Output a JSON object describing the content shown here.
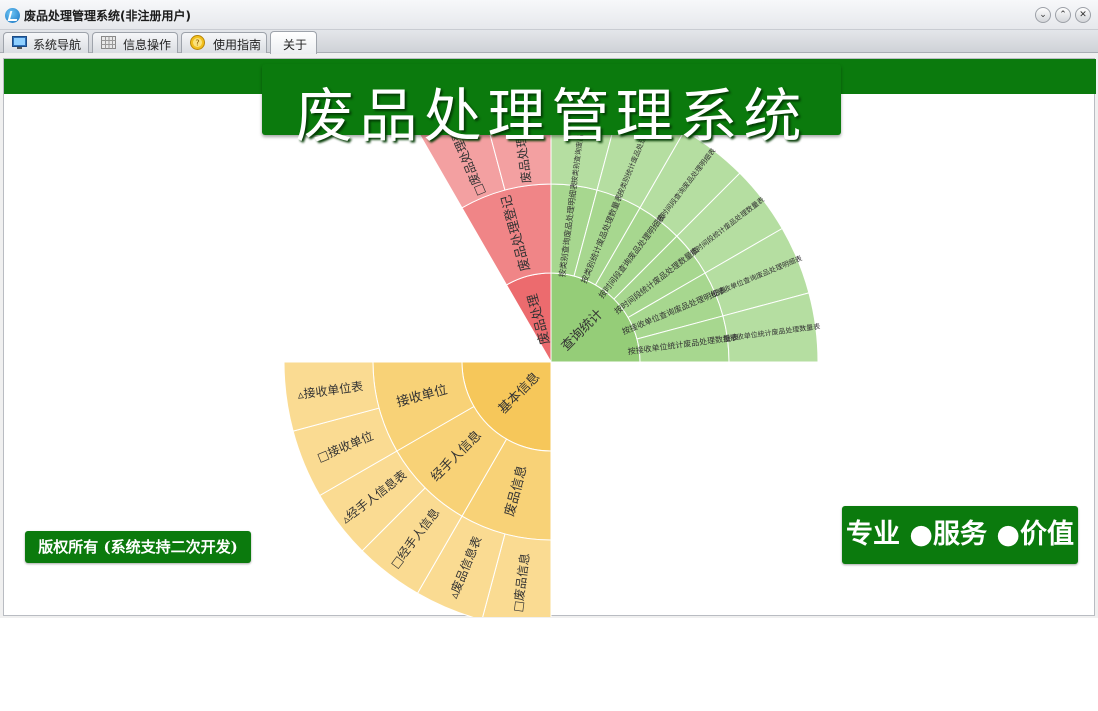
{
  "window": {
    "title": "废品处理管理系统(非注册用户)"
  },
  "tabs": [
    {
      "label": "系统导航",
      "icon": "monitor-icon"
    },
    {
      "label": "信息操作",
      "icon": "grid-icon"
    },
    {
      "label": "使用指南",
      "icon": "help-coin-icon"
    },
    {
      "label": "关于",
      "icon": ""
    }
  ],
  "banner": {
    "title": "废品处理管理系统"
  },
  "copyright": "版权所有 (系统支持二次开发)",
  "slogan": "专业 ●服务 ●价值",
  "colors": {
    "green": "#0b7a0d",
    "red": "#ec6b6e",
    "yellow": "#f6c75a",
    "lightgreen": "#95cd78"
  },
  "sunburst": {
    "center": "",
    "sections": [
      {
        "label": "废品处理",
        "color": "#ec6b6e",
        "children": [
          {
            "label": "废品处理登记",
            "color": "#f08587",
            "children": [
              {
                "label": "□废品处理登记",
                "color": "#f3a0a1"
              },
              {
                "label": "废品处理登记表",
                "color": "#f3a0a1"
              }
            ]
          }
        ]
      },
      {
        "label": "查询统计",
        "color": "#95cd78",
        "children": [
          {
            "label": "按类别查询废品处理明细表",
            "color": "#a7d78f",
            "children": [
              {
                "label": "按类别查询废品处理明细表",
                "color": "#b5dea1"
              }
            ]
          },
          {
            "label": "按类别统计废品处理数量表",
            "color": "#a7d78f",
            "children": [
              {
                "label": "按类别统计废品处理数量表",
                "color": "#b5dea1"
              }
            ]
          },
          {
            "label": "按时间段查询废品处理明细表",
            "color": "#a7d78f",
            "children": [
              {
                "label": "按时间段查询废品处理明细表",
                "color": "#b5dea1"
              }
            ]
          },
          {
            "label": "按时间段统计废品处理数量表",
            "color": "#a7d78f",
            "children": [
              {
                "label": "按时间段统计废品处理数量表",
                "color": "#b5dea1"
              }
            ]
          },
          {
            "label": "按接收单位查询废品处理明细表",
            "color": "#a7d78f",
            "children": [
              {
                "label": "按接收单位查询废品处理明细表",
                "color": "#b5dea1"
              }
            ]
          },
          {
            "label": "按接收单位统计废品处理数量表",
            "color": "#a7d78f",
            "children": [
              {
                "label": "按接收单位统计废品处理数量表",
                "color": "#b5dea1"
              }
            ]
          }
        ]
      },
      {
        "label": "基本信息",
        "color": "#f6c75a",
        "children": [
          {
            "label": "废品信息",
            "color": "#f8d277",
            "children": [
              {
                "label": "□废品信息",
                "color": "#fadb92"
              },
              {
                "label": "▵废品信息表",
                "color": "#fadb92"
              }
            ]
          },
          {
            "label": "经手人信息",
            "color": "#f8d277",
            "children": [
              {
                "label": "□经手人信息",
                "color": "#fadb92"
              },
              {
                "label": "▵经手人信息表",
                "color": "#fadb92"
              }
            ]
          },
          {
            "label": "接收单位",
            "color": "#f8d277",
            "children": [
              {
                "label": "□接收单位",
                "color": "#fadb92"
              },
              {
                "label": "▵接收单位表",
                "color": "#fadb92"
              }
            ]
          }
        ]
      }
    ]
  }
}
